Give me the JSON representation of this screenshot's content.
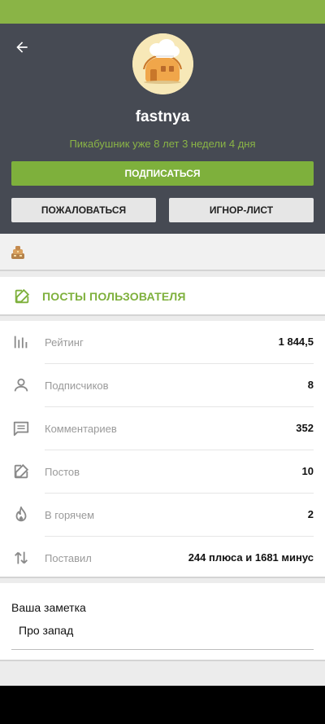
{
  "profile": {
    "username": "fastnya",
    "tenure": "Пикабушник уже 8 лет 3 недели 4 дня",
    "subscribe_label": "ПОДПИСАТЬСЯ",
    "report_label": "ПОЖАЛОВАТЬСЯ",
    "ignore_label": "ИГНОР-ЛИСТ",
    "back_icon": "arrow-left-icon",
    "avatar_icon": "house-with-chef-hat-avatar"
  },
  "awards": {
    "badge_icon": "award-badge-icon"
  },
  "posts": {
    "label": "ПОСТЫ ПОЛЬЗОВАТЕЛЯ",
    "icon": "edit-icon"
  },
  "stats": [
    {
      "label": "Рейтинг",
      "value": "1 844,5",
      "icon": "bar-chart-icon"
    },
    {
      "label": "Подписчиков",
      "value": "8",
      "icon": "person-icon"
    },
    {
      "label": "Комментариев",
      "value": "352",
      "icon": "comment-icon"
    },
    {
      "label": "Постов",
      "value": "10",
      "icon": "edit-icon"
    },
    {
      "label": "В горячем",
      "value": "2",
      "icon": "flame-icon"
    },
    {
      "label": "Поставил",
      "value": "244 плюса и 1681 минус",
      "icon": "swap-vertical-icon"
    }
  ],
  "note": {
    "title": "Ваша заметка",
    "text": "Про запад"
  },
  "colors": {
    "accent_green": "#7eb03c",
    "status_bar": "#8ab446",
    "header_bg": "#464a53"
  }
}
